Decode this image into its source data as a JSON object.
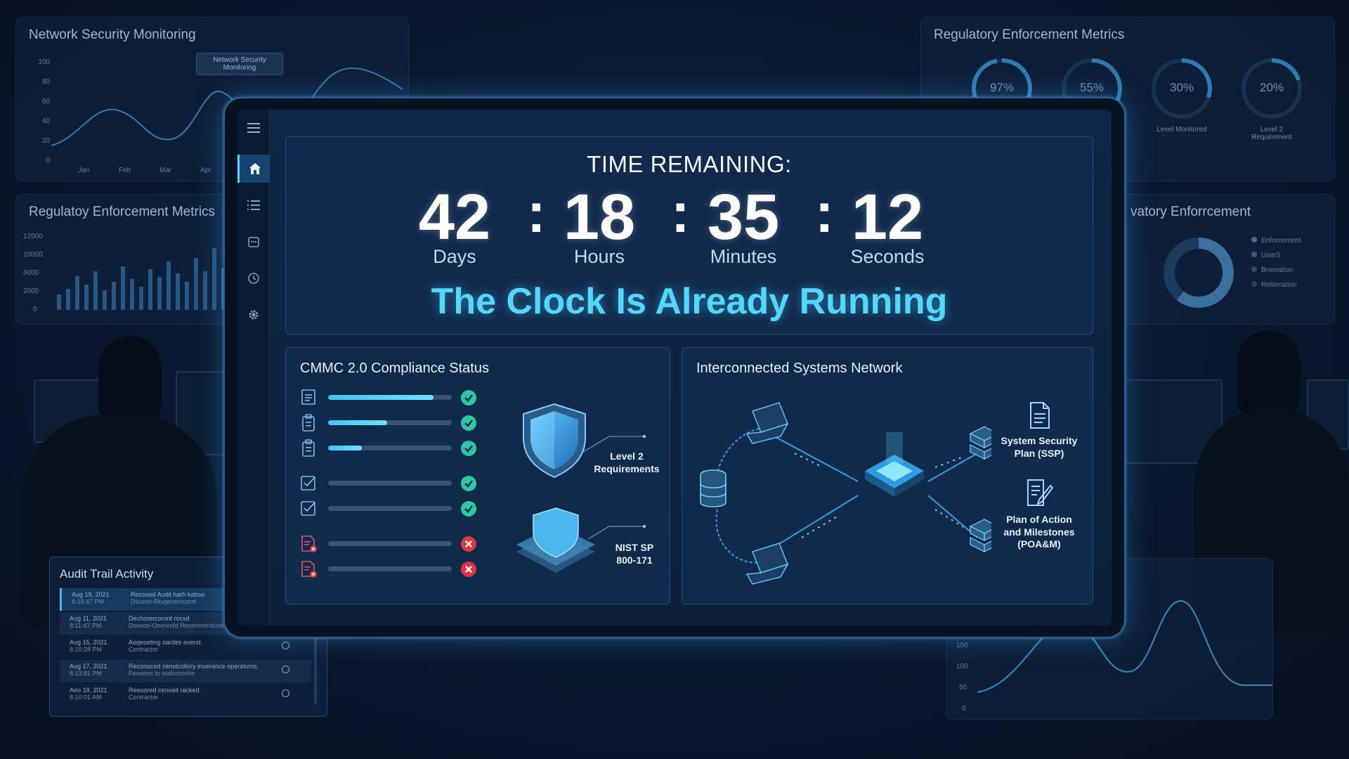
{
  "background": {
    "net_panel": {
      "title": "Network Security Monitoring",
      "tooltip": "Network Security Monitoring",
      "y_ticks": [
        "100",
        "80",
        "60",
        "40",
        "20",
        "0"
      ],
      "x_ticks": [
        "Jan",
        "Feb",
        "Mar",
        "Apr"
      ]
    },
    "reg_panel_top": {
      "title": "Regulatory Enforcement Metrics",
      "gauges": [
        {
          "value": "97%",
          "pct": 97,
          "label": ""
        },
        {
          "value": "55%",
          "pct": 55,
          "label": ""
        },
        {
          "value": "30%",
          "pct": 30,
          "label": "Level Monitored"
        },
        {
          "value": "20%",
          "pct": 20,
          "label": "Level 2 Requirement"
        }
      ]
    },
    "reg_panel_left": {
      "title": "Regulatoy Enforcement Metrics",
      "y_ticks": [
        "12000",
        "10000",
        "6000",
        "2000",
        "0"
      ]
    },
    "reg_panel_right": {
      "title": "vatory Enforrcement",
      "legend": [
        "Enforcement",
        "UserS",
        "Bnenation",
        "Reliteration"
      ]
    },
    "audit": {
      "title": "Audit Trail Activity",
      "rows": [
        {
          "date": "Aug 19, 2021",
          "time": "8:18:47 PM",
          "msg": "Recoxed Audit harh kabso",
          "sub": "Dscxon-Rtugenerxcenti"
        },
        {
          "date": "Aug 11, 2021",
          "time": "8:11:47 PM",
          "msg": "Dechorercoront rocxd",
          "sub": "Dsexon-Onenndd Recenmeniiuon"
        },
        {
          "date": "Aug 15, 2021",
          "time": "8:10:28 PM",
          "msg": "Aoqeoeting oardes evend.",
          "sub": "Contractor"
        },
        {
          "date": "Aug 17, 2021",
          "time": "8:13:81 PM",
          "msg": "Reconoced zenolcollory inuerance operatums.",
          "sub": "Fenoeoc to tsaforcoolm"
        },
        {
          "date": "Aeo 19, 2021",
          "time": "8:10:01 AM",
          "msg": "Reeoored cenoeit racked.",
          "sub": "Contractor"
        }
      ]
    },
    "wave_panel": {
      "y_ticks": [
        "150",
        "100",
        "50",
        "0"
      ]
    }
  },
  "countdown": {
    "title": "TIME REMAINING:",
    "days": "42",
    "days_label": "Days",
    "hours": "18",
    "hours_label": "Hours",
    "minutes": "35",
    "minutes_label": "Minutes",
    "seconds": "12",
    "seconds_label": "Seconds",
    "separator": ":",
    "tagline": "The Clock Is Already Running"
  },
  "compliance": {
    "title": "CMMC 2.0 Compliance Status",
    "items": [
      {
        "icon": "document",
        "progress": 0.85,
        "status": "ok"
      },
      {
        "icon": "clipboard",
        "progress": 0.48,
        "status": "ok"
      },
      {
        "icon": "clipboard",
        "progress": 0.27,
        "status": "ok"
      },
      {
        "icon": "checkbox",
        "progress": 0,
        "status": "ok"
      },
      {
        "icon": "checkbox",
        "progress": 0,
        "status": "ok"
      },
      {
        "icon": "document-error",
        "progress": 0,
        "status": "fail"
      },
      {
        "icon": "document-error",
        "progress": 0,
        "status": "fail"
      }
    ],
    "shield1_label": "Level 2\nRequirements",
    "shield2_label": "NIST SP\n800-171"
  },
  "network": {
    "title": "Interconnected Systems Network",
    "ssp_label": "System Security\nPlan (SSP)",
    "poam_label": "Plan of Action\nand Milestones\n(POA&M)"
  },
  "colors": {
    "accent": "#53d6ff",
    "ok": "#2fc6a4",
    "fail": "#e0343f",
    "frame": "#2d5f90"
  }
}
